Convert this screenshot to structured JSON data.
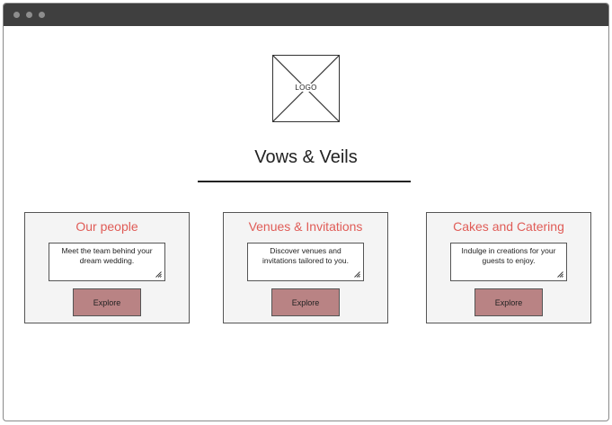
{
  "window": {
    "titlebar_color": "#3f3f3f"
  },
  "logo": {
    "text": "LOGO",
    "icon": "placeholder-image-icon"
  },
  "site": {
    "title": "Vows & Veils"
  },
  "cards": [
    {
      "title": "Our people",
      "description": "Meet the team behind your dream wedding.",
      "button_label": "Explore"
    },
    {
      "title": "Venues & Invitations",
      "description": "Discover venues and invitations tailored to you.",
      "button_label": "Explore"
    },
    {
      "title": "Cakes and Catering",
      "description": "Indulge in creations for your guests to enjoy.",
      "button_label": "Explore"
    }
  ],
  "colors": {
    "accent": "#e05c57",
    "button": "#b98384",
    "card_bg": "#f4f4f4"
  }
}
